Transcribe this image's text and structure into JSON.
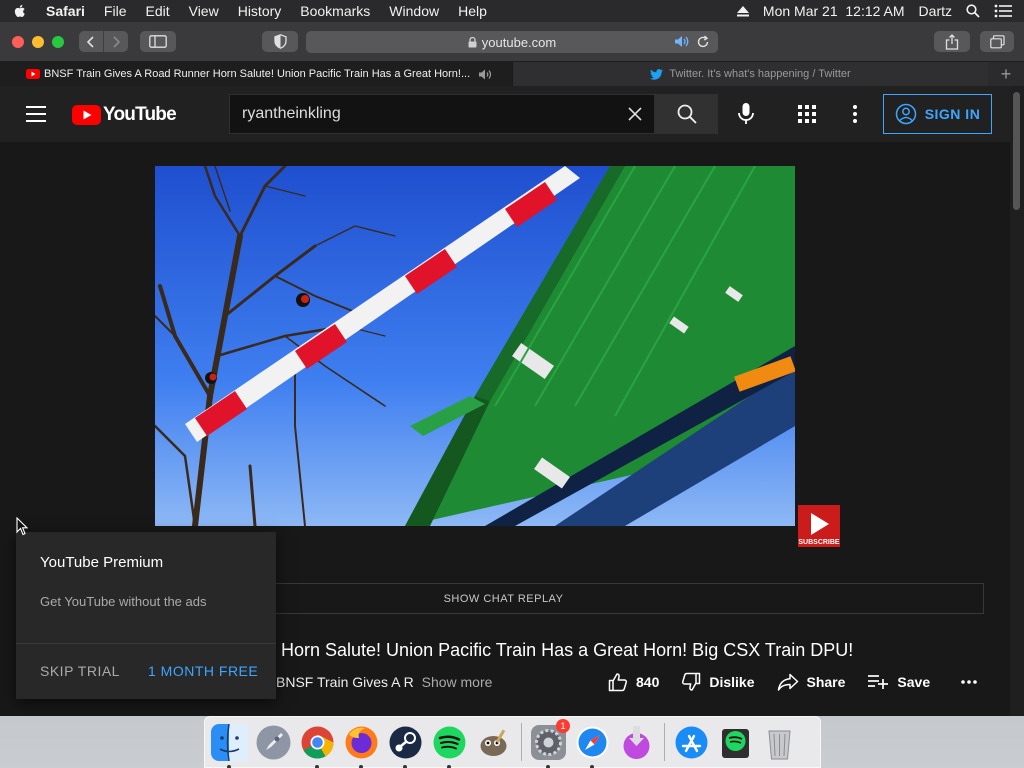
{
  "menubar": {
    "app": "Safari",
    "items": [
      "File",
      "Edit",
      "View",
      "History",
      "Bookmarks",
      "Window",
      "Help"
    ],
    "datetime": "Mon Mar 21  12:12 AM",
    "user": "Dartz"
  },
  "safari": {
    "url": "youtube.com",
    "tabs": [
      {
        "title": "BNSF Train Gives A Road Runner Horn Salute! Union Pacific Train Has a Great Horn!...",
        "active": true,
        "muted": true
      },
      {
        "title": "Twitter. It's what's happening / Twitter",
        "active": false
      }
    ],
    "new_tab": "+"
  },
  "youtube": {
    "logo_text": "YouTube",
    "search_value": "ryantheinkling",
    "sign_in": "SIGN IN",
    "subscribe_watermark": "SUBSCRIBE",
    "chat_replay": "SHOW CHAT REPLAY",
    "video_title": "er Horn Salute! Union Pacific Train Has a Great Horn! Big CSX Train DPU!",
    "description_snippet": "BNSF Train Gives A R",
    "show_more": "Show more",
    "likes": "840",
    "dislike": "Dislike",
    "share": "Share",
    "save": "Save"
  },
  "premium_popup": {
    "title": "YouTube Premium",
    "description": "Get YouTube without the ads",
    "skip": "SKIP TRIAL",
    "cta": "1 MONTH FREE"
  },
  "dock": {
    "apps": [
      "finder-icon",
      "launchpad-icon",
      "chrome-icon",
      "firefox-icon",
      "steam-icon",
      "spotify-icon",
      "gimp-icon",
      "system-preferences-icon",
      "safari-icon",
      "downloader-icon",
      "app-store-icon",
      "spotify-alt-icon",
      "trash-icon"
    ],
    "badge_count": "1"
  },
  "colors": {
    "youtube_red": "#ff0000",
    "link_blue": "#3ea6ff",
    "page_bg": "#181818"
  }
}
